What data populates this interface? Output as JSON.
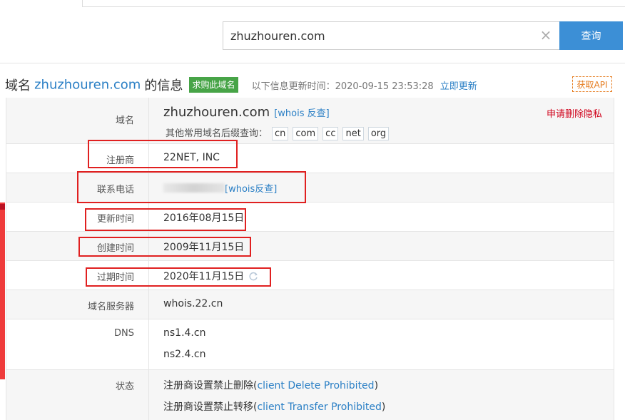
{
  "search": {
    "value": "zhuzhouren.com",
    "button_label": "查询",
    "clear_icon": "close-icon"
  },
  "header": {
    "prefix": "域名",
    "domain": "zhuzhouren.com",
    "suffix": "的信息",
    "buy_badge": "求购此域名",
    "update_text": "以下信息更新时间：2020-09-15 23:53:28",
    "update_link": "立即更新",
    "api_label": "获取API"
  },
  "domain_row": {
    "label": "域名",
    "domain": "zhuzhouren.com",
    "whois_reverse": "[whois 反查]",
    "privacy_link": "申请删除隐私",
    "suffix_prompt": "其他常用域名后缀查询：",
    "suffixes": [
      "cn",
      "com",
      "cc",
      "net",
      "org"
    ]
  },
  "rows": {
    "registrar": {
      "label": "注册商",
      "value": "22NET, INC"
    },
    "phone": {
      "label": "联系电话",
      "whois_link": "[whois反查]"
    },
    "updated": {
      "label": "更新时间",
      "value": "2016年08月15日"
    },
    "created": {
      "label": "创建时间",
      "value": "2009年11月15日"
    },
    "expires": {
      "label": "过期时间",
      "value": "2020年11月15日"
    },
    "server": {
      "label": "域名服务器",
      "value": "whois.22.cn"
    },
    "dns": {
      "label": "DNS",
      "values": [
        "ns1.4.cn",
        "ns2.4.cn"
      ]
    },
    "status": {
      "label": "状态",
      "items": [
        {
          "text": "注册商设置禁止删除(",
          "code": "client Delete Prohibited",
          "close": ")"
        },
        {
          "text": "注册商设置禁止转移(",
          "code": "client Transfer Prohibited",
          "close": ")"
        }
      ]
    }
  },
  "colors": {
    "accent_blue": "#3c8fd6",
    "link_blue": "#2a7fc5",
    "badge_green": "#47a447",
    "highlight_red": "#e02020",
    "api_orange": "#e67e22"
  }
}
